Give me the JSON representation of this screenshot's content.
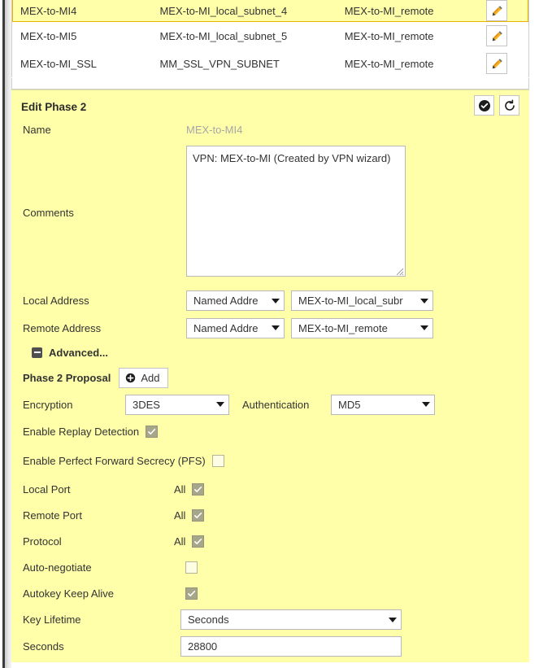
{
  "table": {
    "rows": [
      {
        "name": "MEX-to-MI4",
        "local": "MEX-to-MI_local_subnet_4",
        "remote": "MEX-to-MI_remote",
        "selected": true
      },
      {
        "name": "MEX-to-MI5",
        "local": "MEX-to-MI_local_subnet_5",
        "remote": "MEX-to-MI_remote",
        "selected": false
      },
      {
        "name": "MEX-to-MI_SSL",
        "local": "MM_SSL_VPN_SUBNET",
        "remote": "MEX-to-MI_remote",
        "selected": false
      }
    ],
    "edit_icon": "pencil-icon"
  },
  "panel": {
    "title": "Edit Phase 2",
    "ok_icon": "check-circle-icon",
    "revert_icon": "undo-arrow-icon",
    "fields": {
      "name_label": "Name",
      "name_value": "MEX-to-MI4",
      "comments_label": "Comments",
      "comments_value": "VPN: MEX-to-MI (Created by VPN wizard)",
      "local_address_label": "Local Address",
      "local_address_type": "Named Addre",
      "local_address_value": "MEX-to-MI_local_subr",
      "remote_address_label": "Remote Address",
      "remote_address_type": "Named Addre",
      "remote_address_value": "MEX-to-MI_remote",
      "advanced_label": "Advanced...",
      "phase2_proposal_label": "Phase 2 Proposal",
      "add_label": "Add",
      "encryption_label": "Encryption",
      "encryption_value": "3DES",
      "authentication_label": "Authentication",
      "authentication_value": "MD5",
      "replay_detection_label": "Enable Replay Detection",
      "replay_detection_checked": true,
      "pfs_label": "Enable Perfect Forward Secrecy (PFS)",
      "pfs_checked": false,
      "local_port_label": "Local Port",
      "local_port_all": "All",
      "local_port_checked": true,
      "remote_port_label": "Remote Port",
      "remote_port_all": "All",
      "remote_port_checked": true,
      "protocol_label": "Protocol",
      "protocol_all": "All",
      "protocol_checked": true,
      "auto_negotiate_label": "Auto-negotiate",
      "auto_negotiate_checked": false,
      "autokey_keep_alive_label": "Autokey Keep Alive",
      "autokey_keep_alive_checked": true,
      "key_lifetime_label": "Key Lifetime",
      "key_lifetime_value": "Seconds",
      "seconds_label": "Seconds",
      "seconds_value": "28800"
    }
  },
  "colors": {
    "panel_yellow": "#FFFFAA",
    "selected_row_border": "#E8B200",
    "readonly_text": "#A6A6A6",
    "checkbox_checked": "#A6A68A"
  }
}
